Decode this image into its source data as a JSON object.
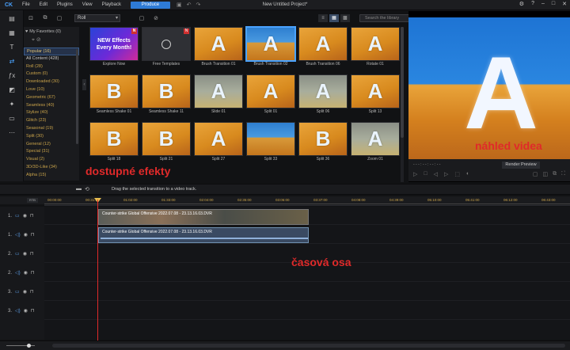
{
  "titlebar": {
    "logo": "CK",
    "menu": [
      "File",
      "Edit",
      "Plugins",
      "View",
      "Playback"
    ],
    "produce_label": "Produce",
    "window_title": "New Untitled Project*"
  },
  "library": {
    "dropdown_value": "Roll",
    "search_placeholder": "Search the library"
  },
  "categories": {
    "favorites": "My Favorites (0)",
    "items": [
      "Popular (16)",
      "All Content (428)",
      "Roll (28)",
      "Custom (0)",
      "Downloaded (30)",
      "Love (10)",
      "Geometric (67)",
      "Seamless (40)",
      "Stylize (40)",
      "Glitch (23)",
      "Seasonal (19)",
      "Split (30)",
      "General (12)",
      "Special (31)",
      "Visual (2)",
      "3D/3D-Like (34)",
      "Alpha (15)"
    ]
  },
  "thumbs": [
    {
      "label": "Explore Now",
      "promo": "NEW Effects Every Month!",
      "badge": "N"
    },
    {
      "label": "Free Templates",
      "badge": "N"
    },
    {
      "label": "Brush Transition 01",
      "glyph": "A"
    },
    {
      "label": "Brush Transition 02",
      "glyph": "A"
    },
    {
      "label": "Brush Transition 06",
      "glyph": "A"
    },
    {
      "label": "Rotate 01",
      "glyph": "A"
    },
    {
      "label": "Seamless Shake 01",
      "glyph": "B"
    },
    {
      "label": "Seamless Shake 11",
      "glyph": "B"
    },
    {
      "label": "Slide 01",
      "glyph": "A"
    },
    {
      "label": "Split 01",
      "glyph": "A"
    },
    {
      "label": "Split 06",
      "glyph": "A"
    },
    {
      "label": "Split 13",
      "glyph": "A"
    },
    {
      "label": "Split 18",
      "glyph": "B"
    },
    {
      "label": "Split 21",
      "glyph": "B"
    },
    {
      "label": "Split 27",
      "glyph": "A"
    },
    {
      "label": "Split 33",
      "glyph": ""
    },
    {
      "label": "Split 36",
      "glyph": "B"
    },
    {
      "label": "Zoom 01",
      "glyph": "A"
    }
  ],
  "overlays": {
    "effects": "dostupné efekty",
    "preview": "náhled videa",
    "timeline": "časová osa"
  },
  "preview": {
    "glyph": "A",
    "timecode": "- - - : - - : - - : - -",
    "render_label": "Render Preview"
  },
  "midbar": {
    "hint": "Drag the selected transition to a video track."
  },
  "ruler": [
    "00:00:00",
    "00:31:00",
    "01:02:00",
    "01:33:00",
    "02:04:00",
    "02:35:00",
    "03:06:00",
    "03:37:00",
    "04:08:00",
    "04:39:00",
    "05:10:00",
    "05:41:00",
    "06:12:00",
    "06:43:00"
  ],
  "tracks": [
    {
      "num": "1.",
      "type": "video"
    },
    {
      "num": "1.",
      "type": "audio"
    },
    {
      "num": "2.",
      "type": "video"
    },
    {
      "num": "2.",
      "type": "audio"
    },
    {
      "num": "3.",
      "type": "video"
    },
    {
      "num": "3.",
      "type": "audio"
    }
  ],
  "clips": {
    "video_label": "Counter-strike  Global Offensive 2022.07.08 - 23.13.16.03.DVR",
    "audio_label": "Counter-strike  Global Offensive 2022.07.08 - 23.13.16.03.DVR"
  },
  "timeline_head": {
    "btn": "RTB"
  }
}
